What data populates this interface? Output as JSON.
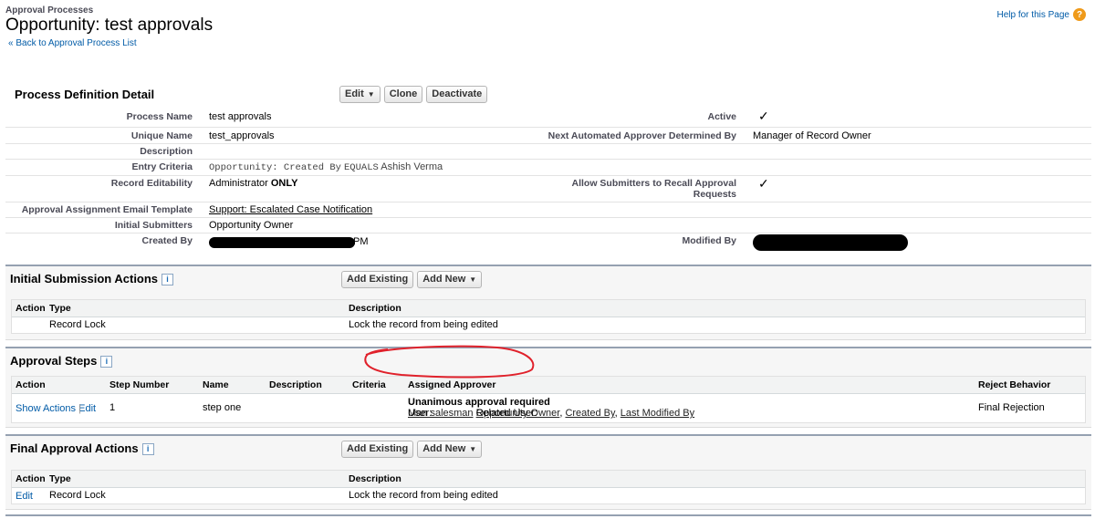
{
  "header": {
    "breadcrumb": "Approval Processes",
    "title": "Opportunity: test approvals",
    "back_link": "« Back to Approval Process List",
    "help_link": "Help for this Page",
    "help_icon": "help-icon"
  },
  "detail": {
    "section_title": "Process Definition Detail",
    "buttons": {
      "edit": "Edit",
      "clone": "Clone",
      "deactivate": "Deactivate"
    },
    "process_name_label": "Process Name",
    "process_name": "test approvals",
    "active_label": "Active",
    "active_icon": "checkmark-icon",
    "unique_name_label": "Unique Name",
    "unique_name": "test_approvals",
    "next_approver_label": "Next Automated Approver Determined By",
    "next_approver": "Manager of Record Owner",
    "description_label": "Description",
    "entry_criteria_label": "Entry Criteria",
    "entry_criteria_field": "Opportunity: Created By",
    "entry_criteria_op": "EQUALS",
    "entry_criteria_value": "Ashish Verma",
    "record_editability_label": "Record Editability",
    "record_editability_prefix": "Administrator",
    "record_editability_suffix": "ONLY",
    "allow_recall_label": "Allow Submitters to Recall Approval Requests",
    "email_template_label": "Approval Assignment Email Template",
    "email_template": "Support: Escalated Case Notification",
    "initial_submitters_label": "Initial Submitters",
    "initial_submitters": "Opportunity Owner",
    "created_by_label": "Created By",
    "created_by_visible": "PM",
    "modified_by_label": "Modified By"
  },
  "initial_submission": {
    "title": "Initial Submission Actions",
    "add_existing": "Add Existing",
    "add_new": "Add New",
    "columns": {
      "action": "Action",
      "type": "Type",
      "description": "Description"
    },
    "rows": [
      {
        "type": "Record Lock",
        "description": "Lock the record from being edited"
      }
    ]
  },
  "approval_steps": {
    "title": "Approval Steps",
    "columns": {
      "action": "Action",
      "step_number": "Step Number",
      "name": "Name",
      "description": "Description",
      "criteria": "Criteria",
      "assigned_approver": "Assigned Approver",
      "reject_behavior": "Reject Behavior"
    },
    "rows": [
      {
        "show_actions": "Show Actions",
        "separator": "|",
        "edit": "Edit",
        "step_number": "1",
        "name": "step one",
        "approval_rule": "Unanimous approval required",
        "user_prefix": "User:",
        "user": "Man salesman",
        "related_prefix": "Related User:",
        "related_users": [
          "Opportunity Owner",
          "Created By",
          "Last Modified By"
        ],
        "reject_behavior": "Final Rejection"
      }
    ]
  },
  "final_approval": {
    "title": "Final Approval Actions",
    "add_existing": "Add Existing",
    "add_new": "Add New",
    "columns": {
      "action": "Action",
      "type": "Type",
      "description": "Description"
    },
    "rows": [
      {
        "action": "Edit",
        "type": "Record Lock",
        "description": "Lock the record from being edited"
      }
    ]
  },
  "colors": {
    "link": "#015ba7",
    "panel_border": "#95a1b1",
    "annotation": "#e0212b"
  }
}
